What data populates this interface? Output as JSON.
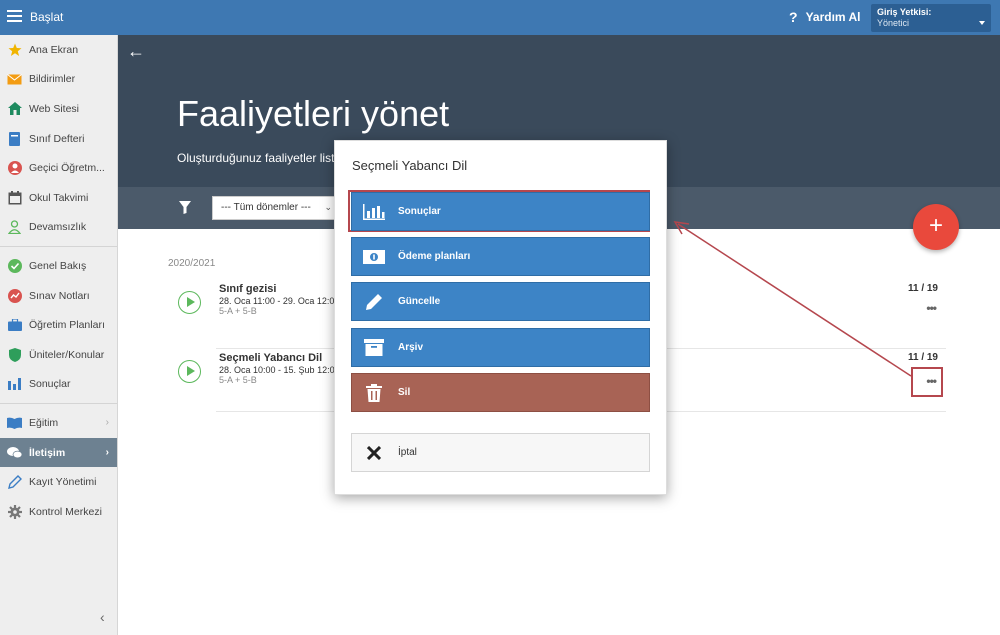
{
  "topbar": {
    "brand": "Başlat",
    "help_label": "Yardım Al",
    "role_label": "Giriş Yetkisi:",
    "role_value": "Yönetici"
  },
  "sidebar": {
    "items": [
      {
        "label": "Ana Ekran",
        "icon": "star-icon",
        "color": "#f0b400"
      },
      {
        "label": "Bildirimler",
        "icon": "envelope-icon",
        "color": "#f39c12"
      },
      {
        "label": "Web Sitesi",
        "icon": "house-icon",
        "color": "#1e8a5f"
      },
      {
        "label": "Sınıf Defteri",
        "icon": "notebook-icon",
        "color": "#3b7dc4"
      },
      {
        "label": "Geçici Öğretm...",
        "icon": "person-badge-icon",
        "color": "#d9534f"
      },
      {
        "label": "Okul Takvimi",
        "icon": "calendar-icon",
        "color": "#555555"
      },
      {
        "label": "Devamsızlık",
        "icon": "person-outline-icon",
        "color": "#5cb85c"
      },
      {
        "label": "Genel Bakış",
        "icon": "check-circle-icon",
        "color": "#5cb85c"
      },
      {
        "label": "Sınav Notları",
        "icon": "grade-circle-icon",
        "color": "#d9534f"
      },
      {
        "label": "Öğretim Planları",
        "icon": "briefcase-icon",
        "color": "#3b7dc4"
      },
      {
        "label": "Üniteler/Konular",
        "icon": "shield-icon",
        "color": "#2e9e5b"
      },
      {
        "label": "Sonuçlar",
        "icon": "bar-chart-icon",
        "color": "#3b7dc4"
      },
      {
        "label": "Eğitim",
        "icon": "book-icon",
        "color": "#3b7dc4"
      },
      {
        "label": "İletişim",
        "icon": "chat-icon",
        "color": "#ffffff"
      },
      {
        "label": "Kayıt Yönetimi",
        "icon": "pencil-icon",
        "color": "#3b7dc4"
      },
      {
        "label": "Kontrol Merkezi",
        "icon": "gear-icon",
        "color": "#777777"
      }
    ]
  },
  "header": {
    "title": "Faaliyetleri yönet",
    "subtitle": "Oluşturduğunuz faaliyetler liste"
  },
  "filters": {
    "term_select": "--- Tüm dönemler ---"
  },
  "list": {
    "year": "2020/2021",
    "activities": [
      {
        "name": "Sınıf gezisi",
        "date": "28. Oca 11:00 - 29. Oca 12:0",
        "classes": "5-A + 5-B",
        "count": "11 / 19"
      },
      {
        "name": "Seçmeli Yabancı Dil",
        "date": "28. Oca 10:00 - 15. Şub 12:0",
        "classes": "5-A + 5-B",
        "count": "11 / 19"
      }
    ]
  },
  "modal": {
    "title": "Seçmeli Yabancı Dil",
    "buttons": {
      "results": "Sonuçlar",
      "payment": "Ödeme planları",
      "update": "Güncelle",
      "archive": "Arşiv",
      "delete": "Sil",
      "cancel": "İptal"
    }
  },
  "colors": {
    "topbar": "#3e78b2",
    "header": "#3a4a5b",
    "primary_button": "#3d84c6",
    "danger_button": "#a86355",
    "fab": "#e9493c",
    "highlight": "#b5474e"
  }
}
